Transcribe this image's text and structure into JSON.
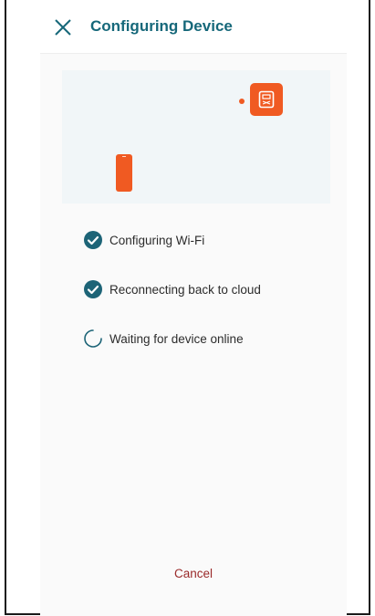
{
  "header": {
    "title": "Configuring Device",
    "close_icon": "close-icon"
  },
  "illustration": {
    "accent_color": "#f05a22",
    "background_color": "#f1f6f8"
  },
  "steps": [
    {
      "label": "Configuring Wi-Fi",
      "status": "done",
      "icon": "check-circle-icon"
    },
    {
      "label": "Reconnecting back to cloud",
      "status": "done",
      "icon": "check-circle-icon"
    },
    {
      "label": "Waiting for device online",
      "status": "in-progress",
      "icon": "spinner-icon"
    }
  ],
  "footer": {
    "cancel_label": "Cancel"
  },
  "colors": {
    "title": "#16687a",
    "check": "#1d6477",
    "cancel": "#9a2a2a"
  }
}
